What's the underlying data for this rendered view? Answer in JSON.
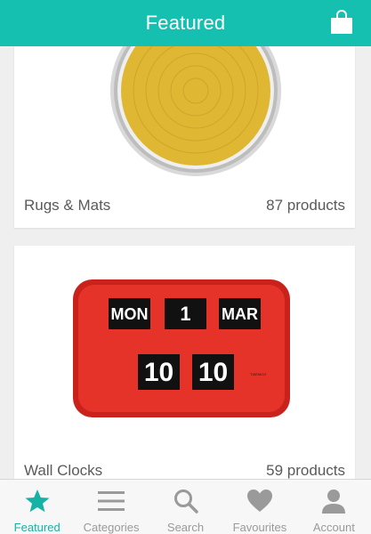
{
  "header": {
    "title": "Featured",
    "cart_icon": "shopping-bag-icon",
    "color": "#16c0b0"
  },
  "categories": [
    {
      "name": "Rugs & Mats",
      "count": "87 products",
      "image": "round-crochet-rug"
    },
    {
      "name": "Wall Clocks",
      "count": "59 products",
      "image": "red-flip-calendar-clock",
      "clock_text": {
        "day": "MON",
        "date": "1",
        "month": "MAR",
        "hour": "10",
        "minute": "10",
        "brand": "TWEMCO"
      }
    }
  ],
  "tabbar": {
    "active_color": "#16b3a5",
    "items": [
      {
        "label": "Featured",
        "icon": "star-icon",
        "active": true
      },
      {
        "label": "Categories",
        "icon": "menu-icon",
        "active": false
      },
      {
        "label": "Search",
        "icon": "search-icon",
        "active": false
      },
      {
        "label": "Favourites",
        "icon": "heart-icon",
        "active": false
      },
      {
        "label": "Account",
        "icon": "person-icon",
        "active": false
      }
    ]
  }
}
